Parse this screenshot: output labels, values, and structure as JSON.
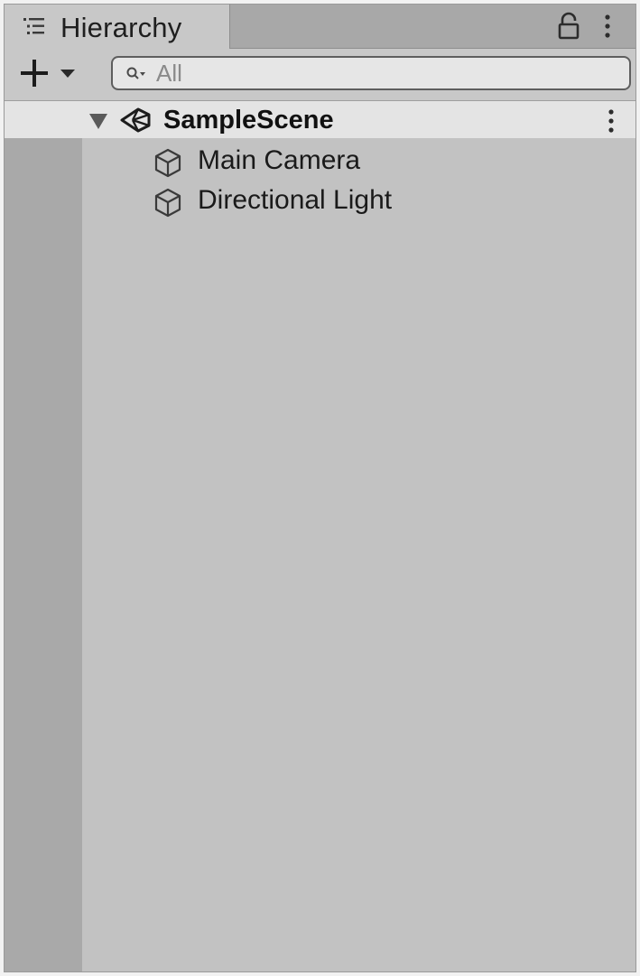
{
  "window": {
    "title": "Hierarchy",
    "tab_icon": "hierarchy-list-icon",
    "lock_icon": "lock-icon",
    "menu_icon": "kebab-menu-icon"
  },
  "toolbar": {
    "add_icon": "plus-icon",
    "dropdown_icon": "chevron-down-icon",
    "search": {
      "icon": "search-icon",
      "placeholder": "All",
      "value": ""
    }
  },
  "hierarchy": {
    "scene": {
      "name": "SampleScene",
      "expanded": true,
      "icon": "unity-scene-icon",
      "menu_icon": "kebab-menu-icon"
    },
    "objects": [
      {
        "label": "Main Camera",
        "icon": "cube-icon"
      },
      {
        "label": "Directional Light",
        "icon": "cube-icon"
      }
    ]
  },
  "colors": {
    "panel_background": "#c2c2c2",
    "tab_background": "#c8c8c8",
    "tabbar_background": "#a8a8a8",
    "scene_row_background": "#e4e4e4",
    "gutter_background": "#a9a9a9",
    "text": "#1a1a1a"
  }
}
